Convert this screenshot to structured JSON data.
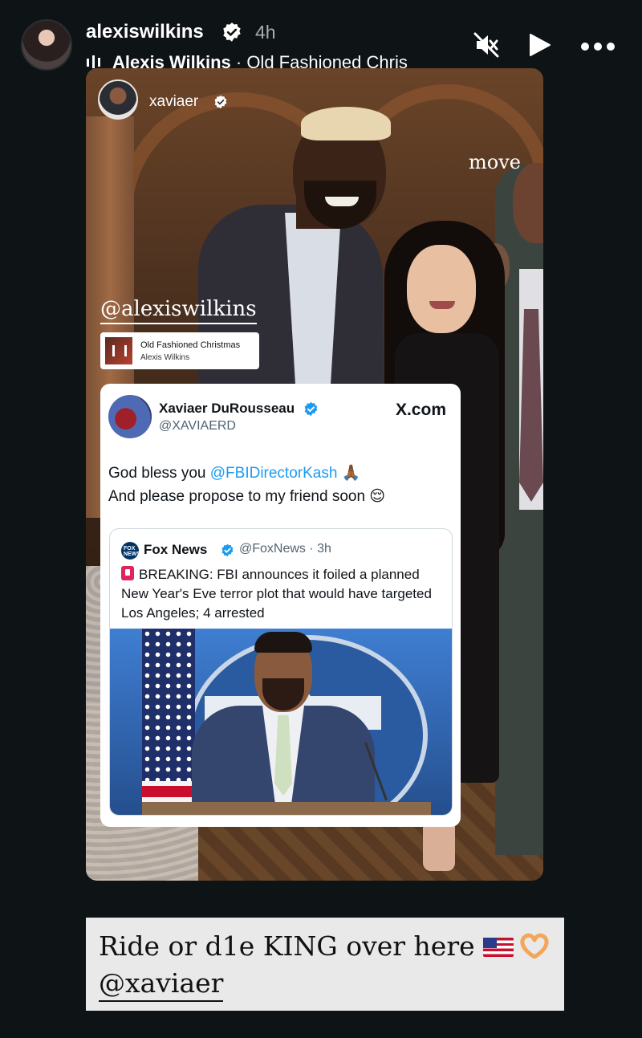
{
  "header": {
    "username": "alexiswilkins",
    "time_ago": "4h",
    "music_artist": "Alexis Wilkins",
    "music_separator": " · ",
    "music_song": "Old Fashioned Chris"
  },
  "story": {
    "repost_username": "xaviaer",
    "move_label": "move",
    "mention": "@alexiswilkins",
    "music_sticker": {
      "title": "Old Fashioned Christmas",
      "artist": "Alexis Wilkins"
    },
    "tweet": {
      "name": "Xaviaer DuRousseau",
      "handle": "@XAVIAERD",
      "source": "X.com",
      "text_prefix": "God bless you ",
      "text_link": "@FBIDirectorKash",
      "text_emoji1": " 🙏🏾",
      "text_line2": "And please propose to my friend soon 😌",
      "quote": {
        "logo_text": "FOX NEWS",
        "name": "Fox News",
        "meta": "@FoxNews · 3h",
        "text": "BREAKING: FBI announces it foiled a planned New Year's Eve terror plot that would have targeted Los Angeles; 4 arrested"
      }
    }
  },
  "caption": {
    "line1": "Ride or d1e KING over here",
    "line2": "@xaviaer"
  },
  "colors": {
    "background": "#0e1316",
    "verified_blue": "#1d9bf0",
    "link_blue": "#1d9bf0"
  },
  "icons": [
    "verified-badge-icon",
    "music-bars-icon",
    "mute-icon",
    "play-icon",
    "more-icon",
    "breaking-alert-icon",
    "flag-emoji-icon",
    "heart-hands-emoji-icon"
  ]
}
